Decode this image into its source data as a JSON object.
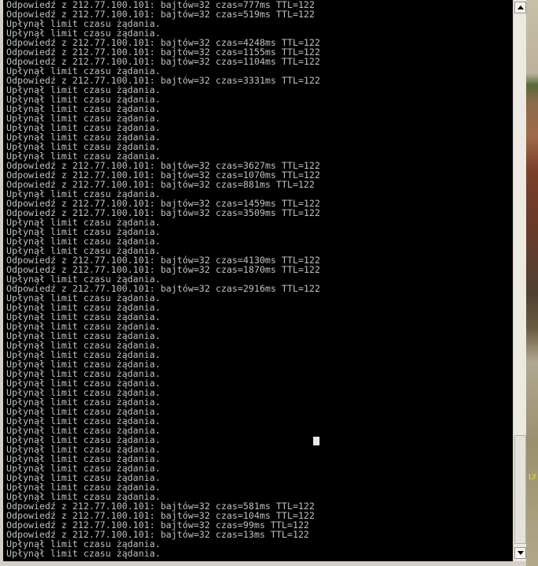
{
  "console": {
    "lines": [
      "Odpowiedź z 212.77.100.101: bajtów=32 czas=777ms TTL=122",
      "Odpowiedź z 212.77.100.101: bajtów=32 czas=519ms TTL=122",
      "Upłynął limit czasu żądania.",
      "Upłynął limit czasu żądania.",
      "Odpowiedź z 212.77.100.101: bajtów=32 czas=4248ms TTL=122",
      "Odpowiedź z 212.77.100.101: bajtów=32 czas=1155ms TTL=122",
      "Odpowiedź z 212.77.100.101: bajtów=32 czas=1104ms TTL=122",
      "Upłynął limit czasu żądania.",
      "Odpowiedź z 212.77.100.101: bajtów=32 czas=3331ms TTL=122",
      "Upłynął limit czasu żądania.",
      "Upłynął limit czasu żądania.",
      "Upłynął limit czasu żądania.",
      "Upłynął limit czasu żądania.",
      "Upłynął limit czasu żądania.",
      "Upłynął limit czasu żądania.",
      "Upłynął limit czasu żądania.",
      "Upłynął limit czasu żądania.",
      "Odpowiedź z 212.77.100.101: bajtów=32 czas=3627ms TTL=122",
      "Odpowiedź z 212.77.100.101: bajtów=32 czas=1070ms TTL=122",
      "Odpowiedź z 212.77.100.101: bajtów=32 czas=881ms TTL=122",
      "Upłynął limit czasu żądania.",
      "Odpowiedź z 212.77.100.101: bajtów=32 czas=1459ms TTL=122",
      "Odpowiedź z 212.77.100.101: bajtów=32 czas=3509ms TTL=122",
      "Upłynął limit czasu żądania.",
      "Upłynął limit czasu żądania.",
      "Upłynął limit czasu żądania.",
      "Upłynął limit czasu żądania.",
      "Odpowiedź z 212.77.100.101: bajtów=32 czas=4130ms TTL=122",
      "Odpowiedź z 212.77.100.101: bajtów=32 czas=1870ms TTL=122",
      "Upłynął limit czasu żądania.",
      "Odpowiedź z 212.77.100.101: bajtów=32 czas=2916ms TTL=122",
      "Upłynął limit czasu żądania.",
      "Upłynął limit czasu żądania.",
      "Upłynął limit czasu żądania.",
      "Upłynął limit czasu żądania.",
      "Upłynął limit czasu żądania.",
      "Upłynął limit czasu żądania.",
      "Upłynął limit czasu żądania.",
      "Upłynął limit czasu żądania.",
      "Upłynął limit czasu żądania.",
      "Upłynął limit czasu żądania.",
      "Upłynął limit czasu żądania.",
      "Upłynął limit czasu żądania.",
      "Upłynął limit czasu żądania.",
      "Upłynął limit czasu żądania.",
      "Upłynął limit czasu żądania.",
      "Upłynął limit czasu żądania.",
      "Upłynął limit czasu żądania.",
      "Upłynął limit czasu żądania.",
      "Upłynął limit czasu żądania.",
      "Upłynął limit czasu żądania.",
      "Upłynął limit czasu żądania.",
      "Upłynął limit czasu żądania.",
      "Odpowiedź z 212.77.100.101: bajtów=32 czas=581ms TTL=122",
      "Odpowiedź z 212.77.100.101: bajtów=32 czas=104ms TTL=122",
      "Odpowiedź z 212.77.100.101: bajtów=32 czas=99ms TTL=122",
      "Odpowiedź z 212.77.100.101: bajtów=32 czas=13ms TTL=122",
      "Upłynął limit czasu żądania.",
      "Upłynął limit czasu żądania."
    ]
  },
  "scrollbar": {
    "up_icon": "scroll-up-arrow",
    "down_icon": "scroll-down-arrow"
  },
  "desktop": {
    "edge_text": "LY"
  },
  "colors": {
    "console_bg": "#000000",
    "console_text": "#c0c0c0",
    "cursor": "#e8e8e8"
  }
}
